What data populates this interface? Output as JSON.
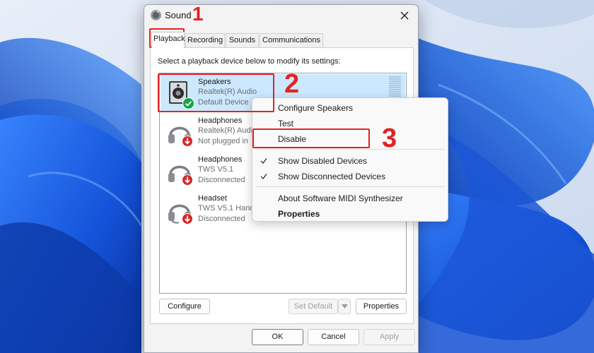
{
  "dialog": {
    "title": "Sound",
    "tabs": [
      "Playback",
      "Recording",
      "Sounds",
      "Communications"
    ],
    "active_tab": "Playback",
    "instruction": "Select a playback device below to modify its settings:",
    "devices": [
      {
        "name": "Speakers",
        "line1": "Realtek(R) Audio",
        "line2": "Default Device",
        "selected": true,
        "icon": "speaker-icon",
        "status": "default-check"
      },
      {
        "name": "Headphones",
        "line1": "Realtek(R) Audio",
        "line2": "Not plugged in",
        "selected": false,
        "icon": "headphones-icon",
        "status": "unplugged-arrow"
      },
      {
        "name": "Headphones",
        "line1": "TWS V5.1",
        "line2": "Disconnected",
        "selected": false,
        "icon": "headphones-icon",
        "status": "unplugged-arrow"
      },
      {
        "name": "Headset",
        "line1": "TWS V5.1 Hands",
        "line2": "Disconnected",
        "selected": false,
        "icon": "headset-icon",
        "status": "unplugged-arrow"
      }
    ],
    "buttons": {
      "configure": "Configure",
      "set_default": "Set Default",
      "properties": "Properties",
      "ok": "OK",
      "cancel": "Cancel",
      "apply": "Apply"
    }
  },
  "context_menu": {
    "items": [
      {
        "label": "Configure Speakers"
      },
      {
        "label": "Test"
      },
      {
        "label": "Disable"
      },
      {
        "label": "Show Disabled Devices",
        "checked": true
      },
      {
        "label": "Show Disconnected Devices",
        "checked": true
      },
      {
        "label": "About Software MIDI Synthesizer"
      },
      {
        "label": "Properties",
        "bold": true
      }
    ]
  },
  "annotations": {
    "step1": "1",
    "step2": "2",
    "step3": "3",
    "color": "#e02424"
  },
  "colors": {
    "selection": "#cce8ff",
    "wallpaper_blue": "#1f5fe0",
    "wallpaper_light": "#dfe9f6",
    "check_green": "#16a34a",
    "unplug_red": "#d62828"
  }
}
